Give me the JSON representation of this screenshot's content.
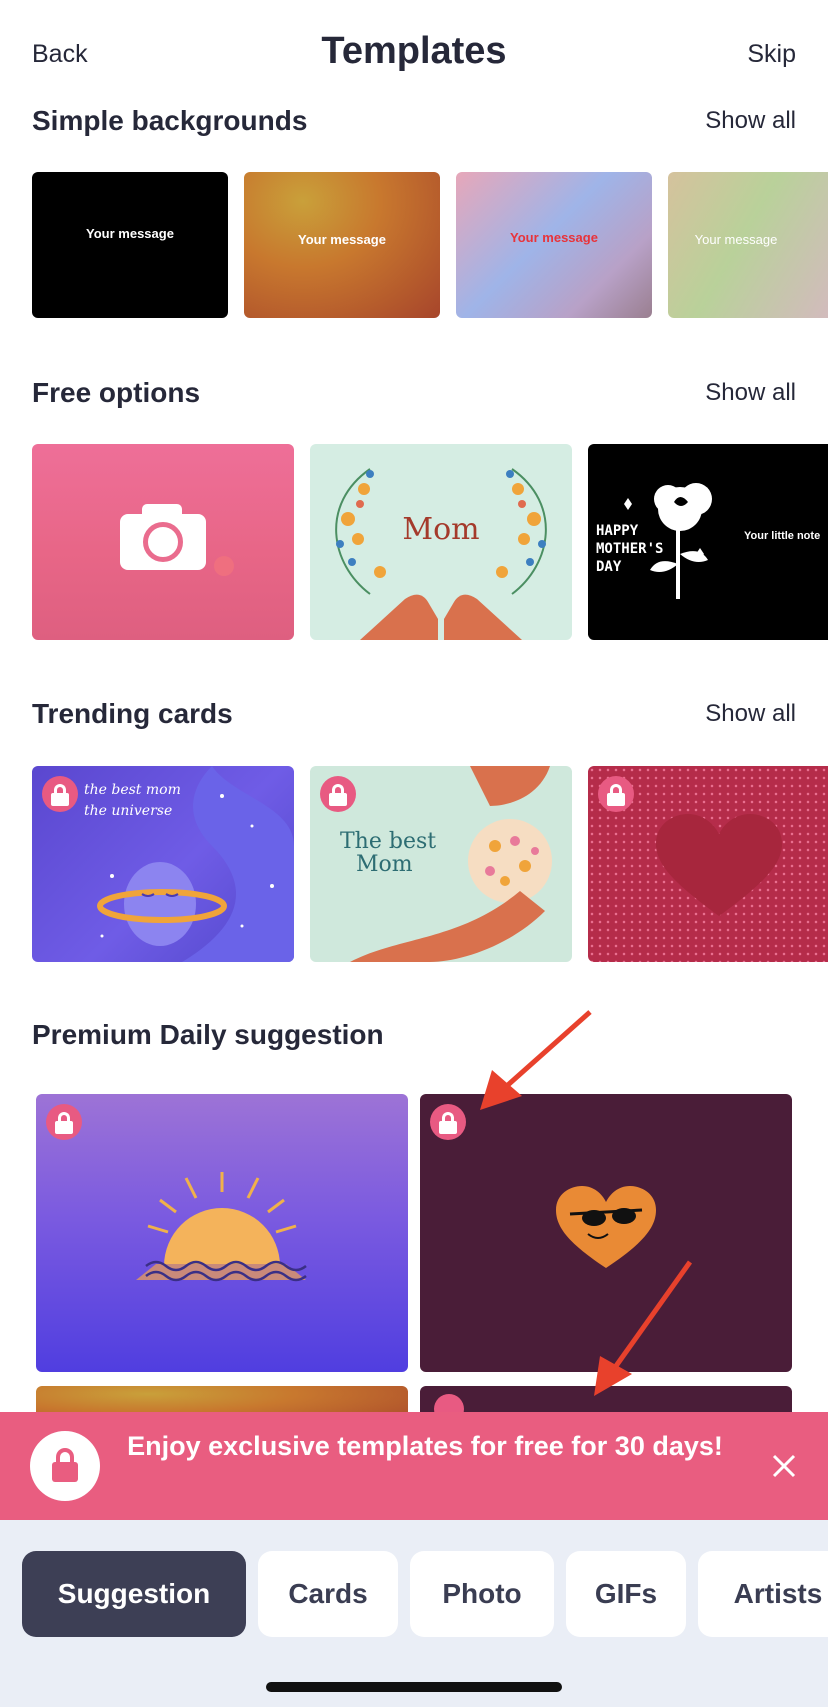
{
  "header": {
    "back_label": "Back",
    "title": "Templates",
    "skip_label": "Skip"
  },
  "sections": {
    "simple": {
      "title": "Simple backgrounds",
      "show_all": "Show all",
      "cards": [
        {
          "message": "Your message"
        },
        {
          "message": "Your message"
        },
        {
          "message": "Your message"
        },
        {
          "message": "Your message"
        }
      ]
    },
    "free": {
      "title": "Free options",
      "show_all": "Show all",
      "cards": [
        {
          "kind": "photo"
        },
        {
          "kind": "illustration",
          "text": "Mom"
        },
        {
          "kind": "illustration",
          "art_text": "HAPPY MOTHER'S DAY",
          "note": "Your little note"
        }
      ]
    },
    "trending": {
      "title": "Trending cards",
      "show_all": "Show all",
      "cards": [
        {
          "text": "the best mom the universe"
        },
        {
          "text_line1": "The best",
          "text_line2": "Mom"
        },
        {
          "kind": "pattern-heart"
        }
      ]
    },
    "premium": {
      "title": "Premium Daily suggestion"
    }
  },
  "banner": {
    "text": "Enjoy exclusive templates for free for 30 days!"
  },
  "tabs": [
    {
      "label": "Suggestion",
      "active": true
    },
    {
      "label": "Cards",
      "active": false
    },
    {
      "label": "Photo",
      "active": false
    },
    {
      "label": "GIFs",
      "active": false
    },
    {
      "label": "Artists",
      "active": false
    }
  ],
  "colors": {
    "accent": "#e95d80",
    "dark": "#262839",
    "tab_active": "#3d3f55",
    "annotation_arrow": "#e8412c"
  }
}
